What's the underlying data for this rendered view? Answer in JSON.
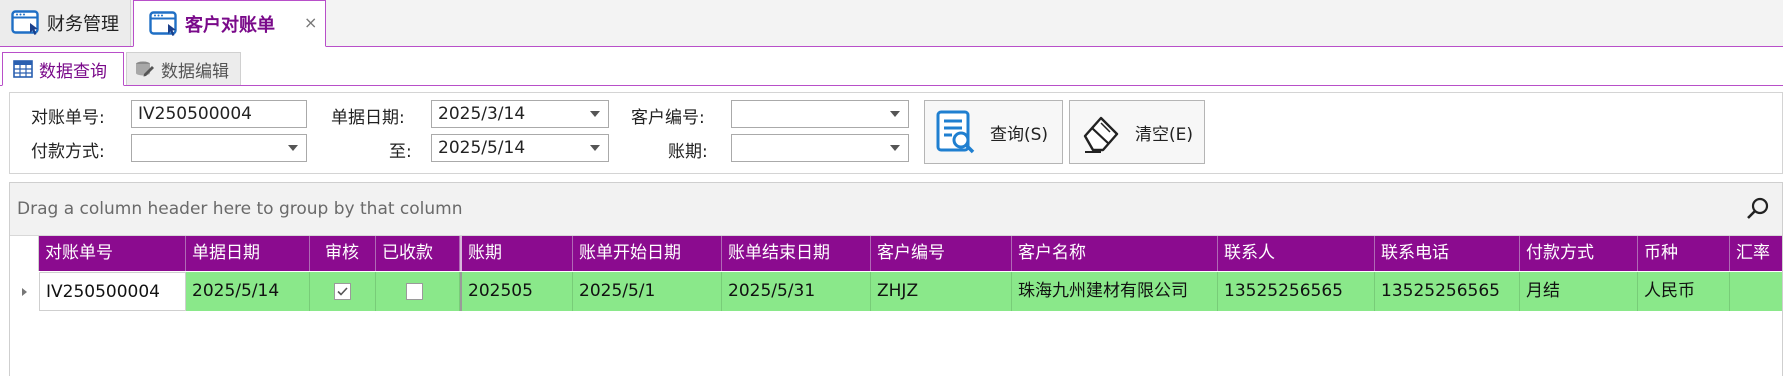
{
  "doc_tabs": [
    {
      "label": "财务管理",
      "icon": "window-icon"
    },
    {
      "label": "客户对账单",
      "icon": "window-icon",
      "close": "×"
    }
  ],
  "inner_tabs": [
    {
      "label": "数据查询",
      "icon": "grid-icon"
    },
    {
      "label": "数据编辑",
      "icon": "database-edit-icon"
    }
  ],
  "filters": {
    "statement_no_label": "对账单号:",
    "statement_no_value": "IV250500004",
    "payment_method_label": "付款方式:",
    "payment_method_value": "",
    "doc_date_label": "单据日期:",
    "doc_date_from": "2025/3/14",
    "to_label": "至:",
    "doc_date_to": "2025/5/14",
    "customer_no_label": "客户编号:",
    "customer_no_value": "",
    "period_label": "账期:",
    "period_value": ""
  },
  "buttons": {
    "query_label": "查询(S)",
    "clear_label": "清空(E)"
  },
  "grid": {
    "group_hint": "Drag a column header here to group by that column",
    "columns": [
      "对账单号",
      "单据日期",
      "审核",
      "已收款",
      "账期",
      "账单开始日期",
      "账单结束日期",
      "客户编号",
      "客户名称",
      "联系人",
      "联系电话",
      "付款方式",
      "币种",
      "汇率"
    ],
    "rows": [
      {
        "statement_no": "IV250500004",
        "doc_date": "2025/5/14",
        "audited": true,
        "received": false,
        "period": "202505",
        "start_date": "2025/5/1",
        "end_date": "2025/5/31",
        "customer_no": "ZHJZ",
        "customer_name": "珠海九州建材有限公司",
        "contact": "13525256565",
        "phone": "13525256565",
        "payment_method": "月结",
        "currency": "人民币",
        "rate": ""
      }
    ]
  },
  "colors": {
    "accent": "#8b0b8f",
    "row_highlight": "#8ae88a",
    "icon_blue": "#1f6fc5"
  }
}
